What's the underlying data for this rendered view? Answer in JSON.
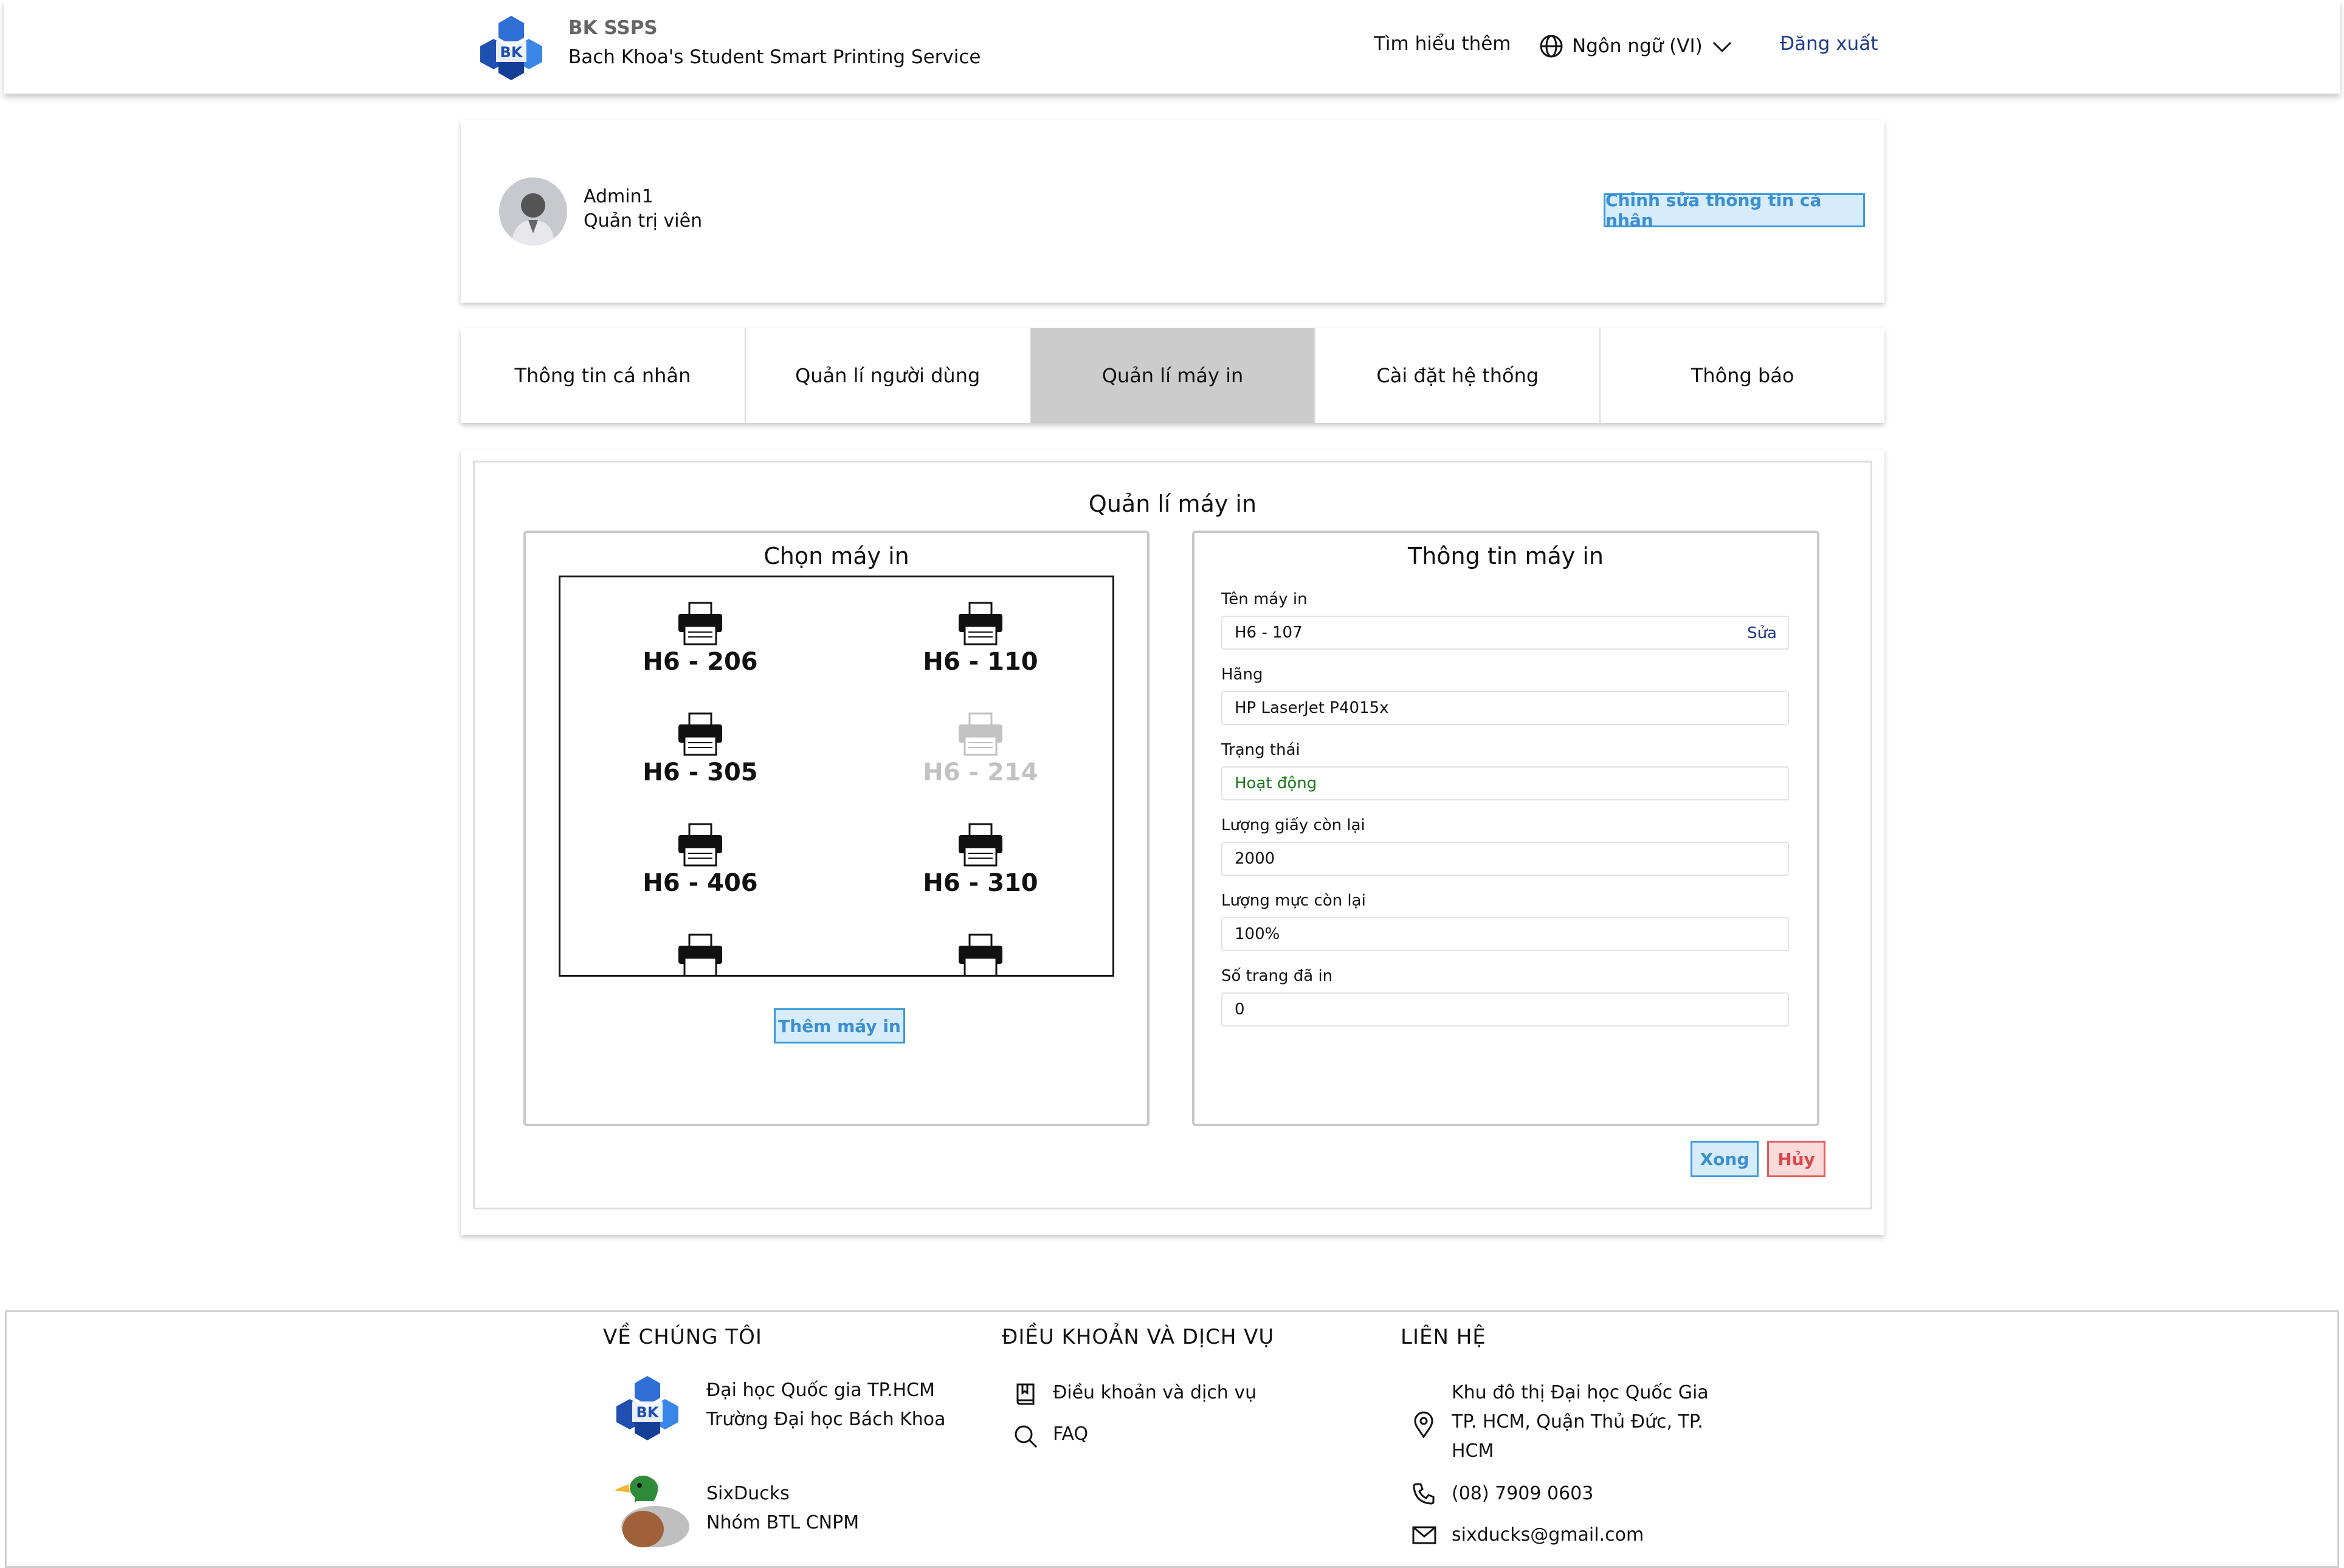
{
  "header": {
    "brand_name": "BK SSPS",
    "brand_sub": "Bach Khoa's Student Smart Printing Service",
    "learn_more": "Tìm hiểu thêm",
    "language": "Ngôn ngữ (VI)",
    "logout": "Đăng xuất",
    "logo_text": "BK"
  },
  "profile": {
    "name": "Admin1",
    "role": "Quản trị viên",
    "edit_button": "Chỉnh sửa thông tin cá nhân"
  },
  "tabs": [
    {
      "label": "Thông tin cá nhân",
      "active": false
    },
    {
      "label": "Quản lí người dùng",
      "active": false
    },
    {
      "label": "Quản lí máy in",
      "active": true
    },
    {
      "label": "Cài đặt hệ thống",
      "active": false
    },
    {
      "label": "Thông báo",
      "active": false
    }
  ],
  "main": {
    "title": "Quản lí máy in",
    "select_panel_title": "Chọn máy in",
    "info_panel_title": "Thông tin máy in",
    "add_printer_button": "Thêm máy in",
    "printers": [
      {
        "name": "H6 - 206",
        "disabled": false
      },
      {
        "name": "H6 - 110",
        "disabled": false
      },
      {
        "name": "H6 - 305",
        "disabled": false
      },
      {
        "name": "H6 - 214",
        "disabled": true
      },
      {
        "name": "H6 - 406",
        "disabled": false
      },
      {
        "name": "H6 - 310",
        "disabled": false
      }
    ],
    "fields": {
      "name_label": "Tên máy in",
      "name_value": "H6 - 107",
      "edit_link": "Sửa",
      "brand_label": "Hãng",
      "brand_value": "HP LaserJet P4015x",
      "status_label": "Trạng thái",
      "status_value": "Hoạt động",
      "paper_label": "Lượng giấy còn lại",
      "paper_value": "2000",
      "ink_label": "Lượng mực còn lại",
      "ink_value": "100%",
      "pages_label": "Số trang đã in",
      "pages_value": "0"
    },
    "done_button": "Xong",
    "cancel_button": "Hủy"
  },
  "footer": {
    "about_heading": "VỀ CHÚNG TÔI",
    "university_line1": "Đại học Quốc gia TP.HCM",
    "university_line2": "Trường Đại học Bách Khoa",
    "team_line1": "SixDucks",
    "team_line2": "Nhóm BTL CNPM",
    "terms_heading": "ĐIỀU KHOẢN VÀ DỊCH VỤ",
    "terms_link": "Điều khoản và dịch vụ",
    "faq_link": "FAQ",
    "contact_heading": "LIÊN HỆ",
    "address_line1": "Khu đô thị Đại học Quốc Gia",
    "address_line2": "TP. HCM, Quận Thủ Đức, TP.",
    "address_line3": "HCM",
    "phone": "(08) 7909 0603",
    "email": "sixducks@gmail.com"
  },
  "colors": {
    "accent_blue": "#3b9ad9",
    "danger_red": "#e45a5a",
    "status_green": "#1a7a1a",
    "link_navy": "#1e3a8a"
  }
}
